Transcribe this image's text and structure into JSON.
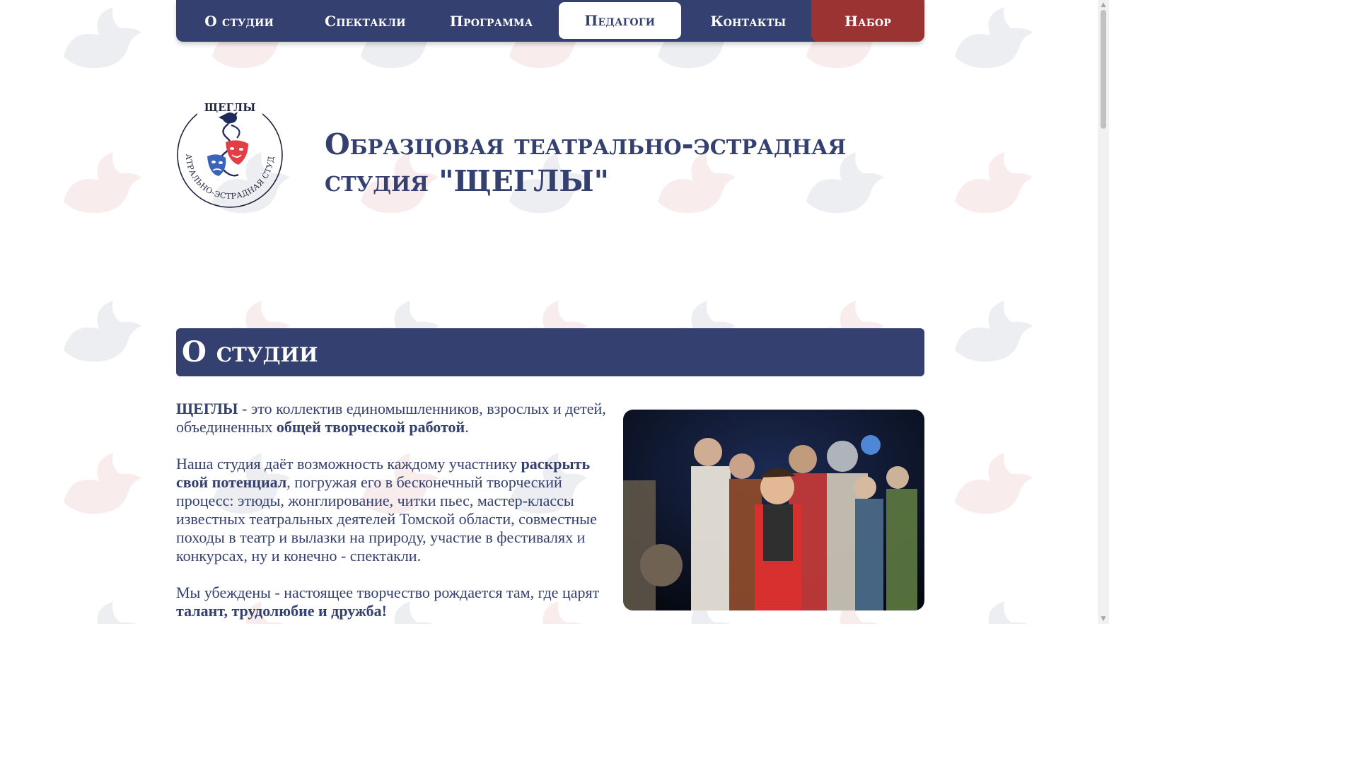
{
  "nav": {
    "items": [
      {
        "label": "О студии"
      },
      {
        "label": "Спектакли"
      },
      {
        "label": "Программа"
      },
      {
        "label": "Педагоги"
      },
      {
        "label": "Контакты"
      },
      {
        "label": "Набор"
      }
    ],
    "active_index": 3
  },
  "header": {
    "title": "Образцовая театрально-эстрадная студия \"ЩЕГЛЫ\"",
    "logo_top_text": "ЩЕГЛЫ",
    "logo_arc_text": "ТЕАТРАЛЬНО-ЭСТРАДНАЯ СТУДИЯ"
  },
  "about": {
    "heading": "О студии",
    "p1": {
      "b1": "ЩЕГЛЫ",
      "t1": " - это коллектив единомышленников, взрослых и детей, объединенных ",
      "b2": "общей творческой работой",
      "t2": "."
    },
    "p2": {
      "t1": "Наша студия даёт возможность каждому участнику ",
      "b1": "раскрыть свой потенциал",
      "t2": ", погружая его в бесконечный творческий процесс: этюды, жонглирование, читки пьес, мастер-классы известных театральных деятелей Томской области, совместные походы в театр и вылазки на природу, участие в фестивалях и конкурсах, ну и конечно - спектакли."
    },
    "p3": {
      "t1": "Мы убеждены - настоящее творчество рождается там, где царят ",
      "b1": "талант, трудолюбие и дружба!"
    }
  },
  "colors": {
    "primary": "#34406f",
    "accent": "#9c3333",
    "white": "#ffffff"
  }
}
